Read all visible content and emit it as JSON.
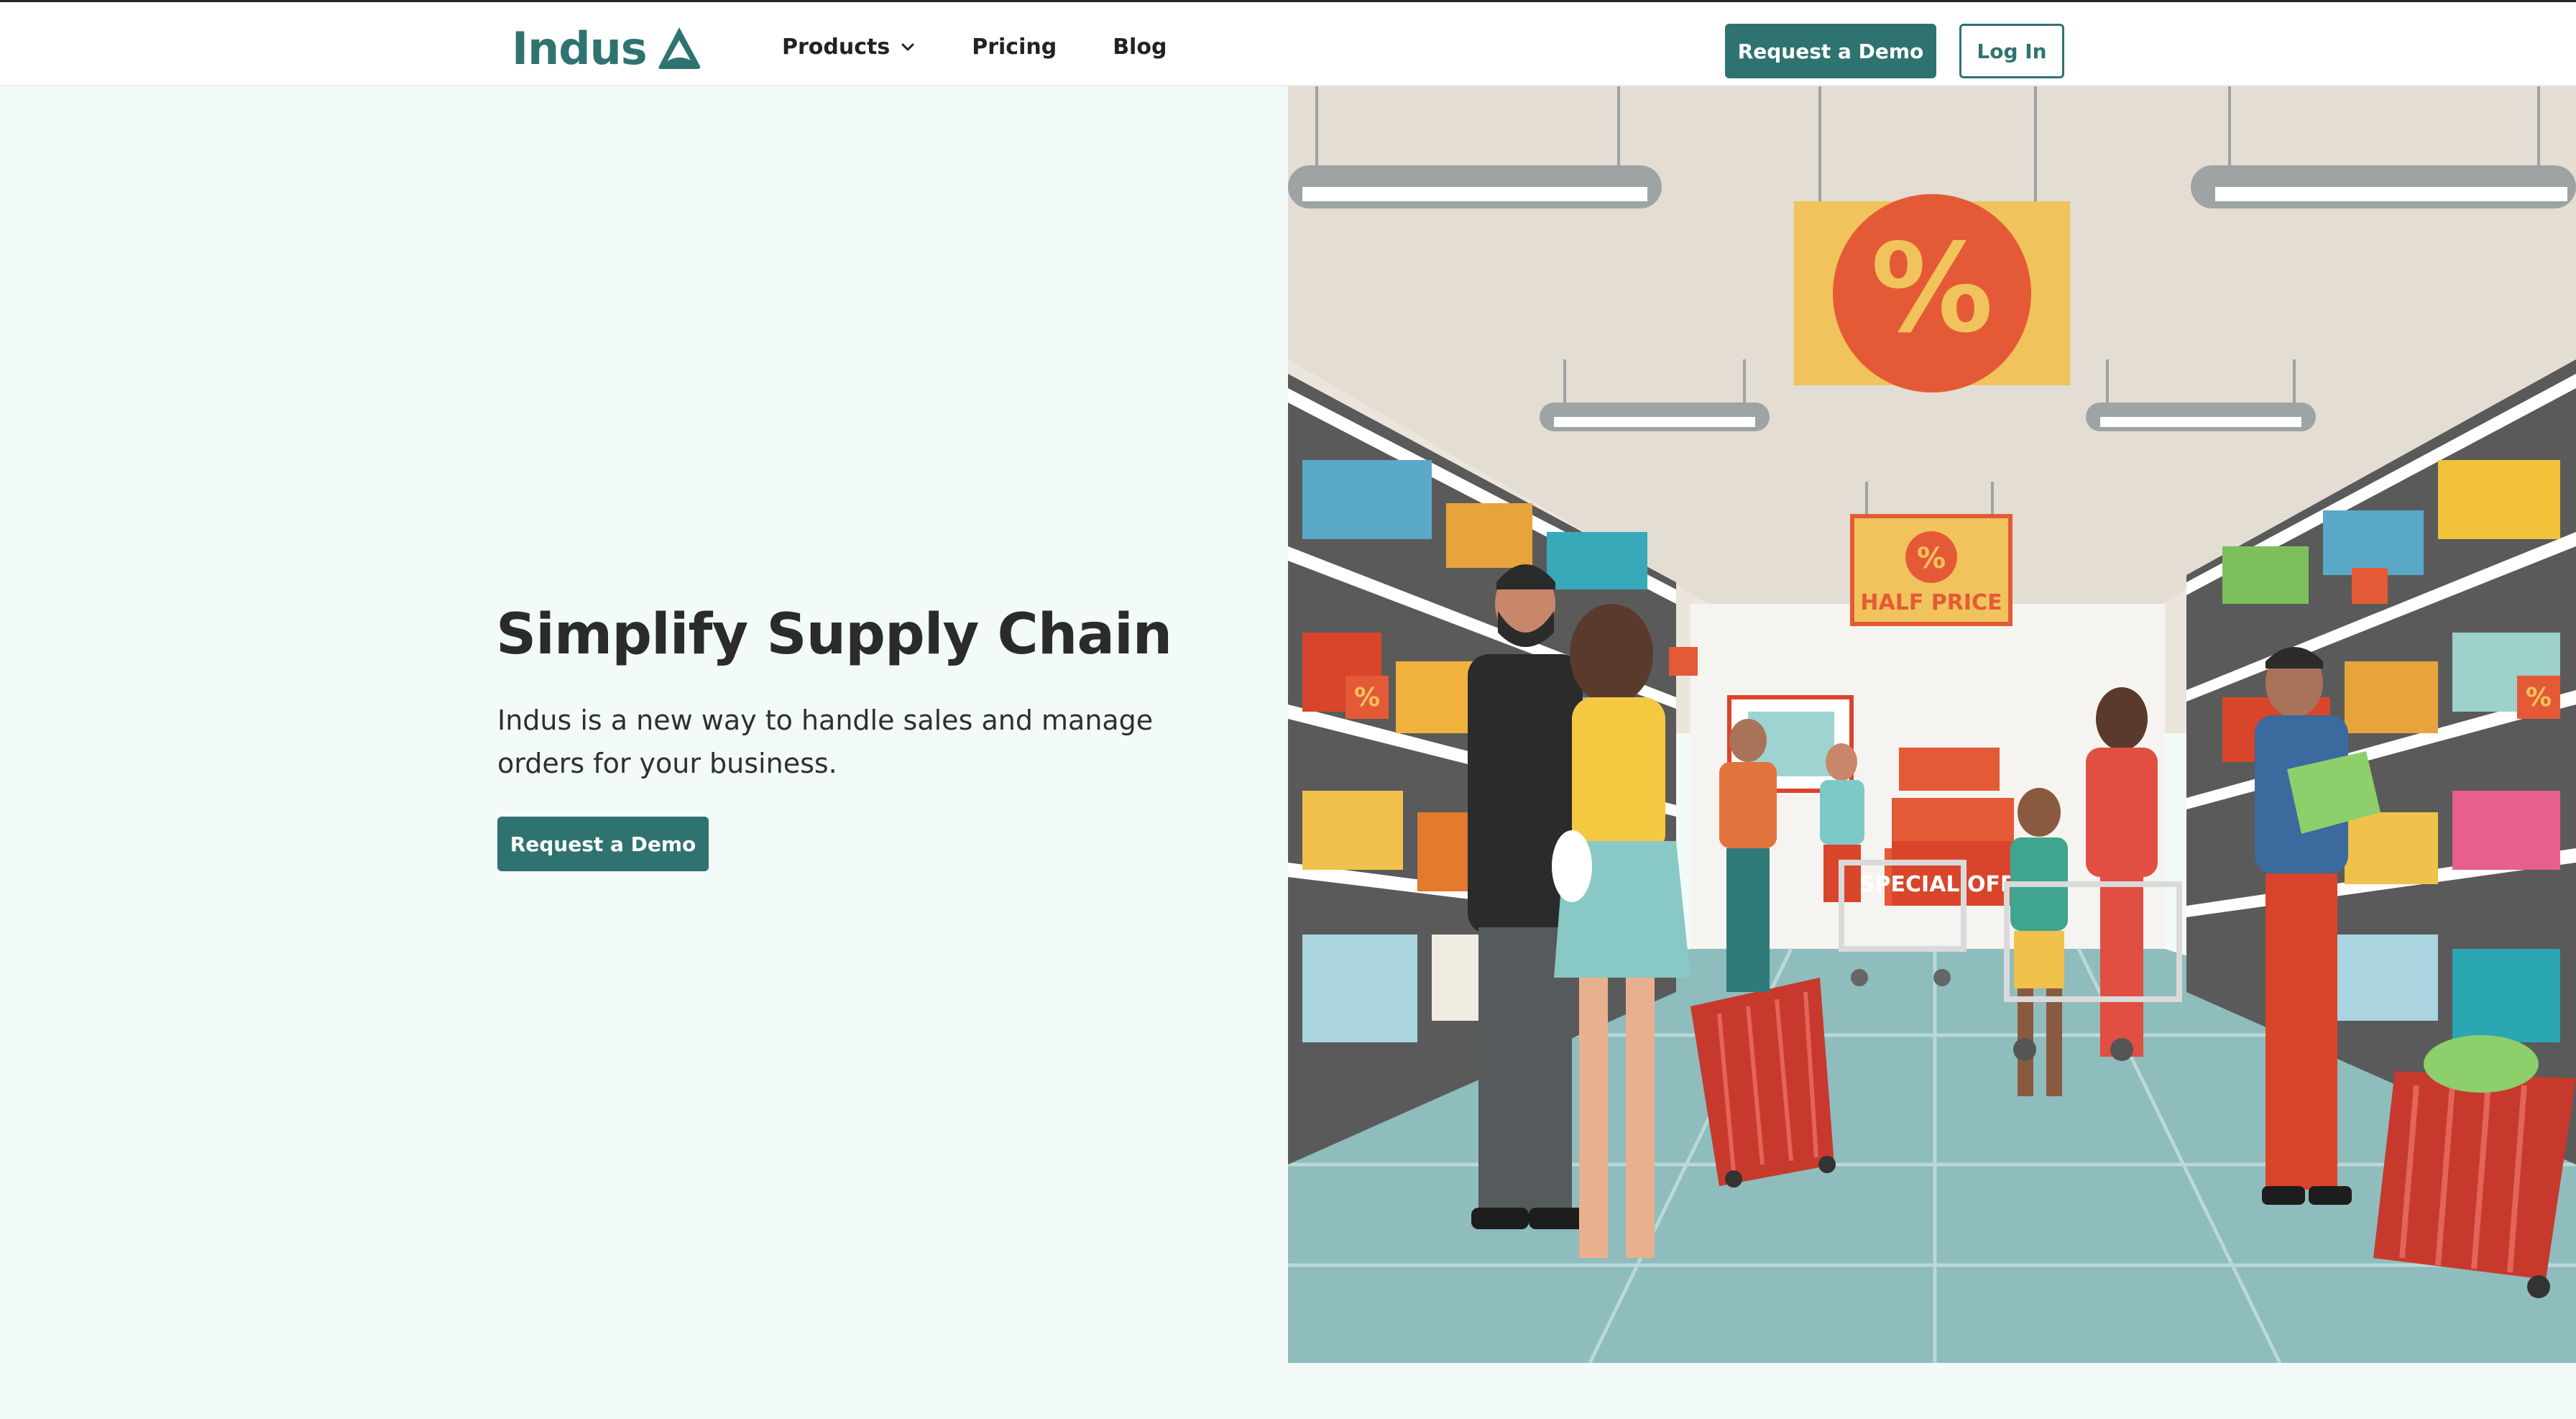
{
  "header": {
    "logo_text": "Indus",
    "logo_icon": "triangle-logo-icon",
    "nav": [
      {
        "label": "Products",
        "has_dropdown": true,
        "icon": "chevron-down-icon"
      },
      {
        "label": "Pricing"
      },
      {
        "label": "Blog"
      }
    ],
    "request_demo_label": "Request a Demo",
    "login_label": "Log In"
  },
  "hero": {
    "title": "Simplify Supply Chain",
    "subtitle": "Indus is a new way to handle sales and manage orders for your business.",
    "cta_label": "Request a Demo"
  },
  "illustration": {
    "sign_main_symbol": "%",
    "sign_half_price": "HALF PRICE",
    "sign_special_offer": "SPECIAL OFFER"
  },
  "colors": {
    "brand": "#2f7370",
    "page_background": "#f3fbf8",
    "header_background": "#ffffff",
    "text_dark": "#2b2b2b"
  }
}
